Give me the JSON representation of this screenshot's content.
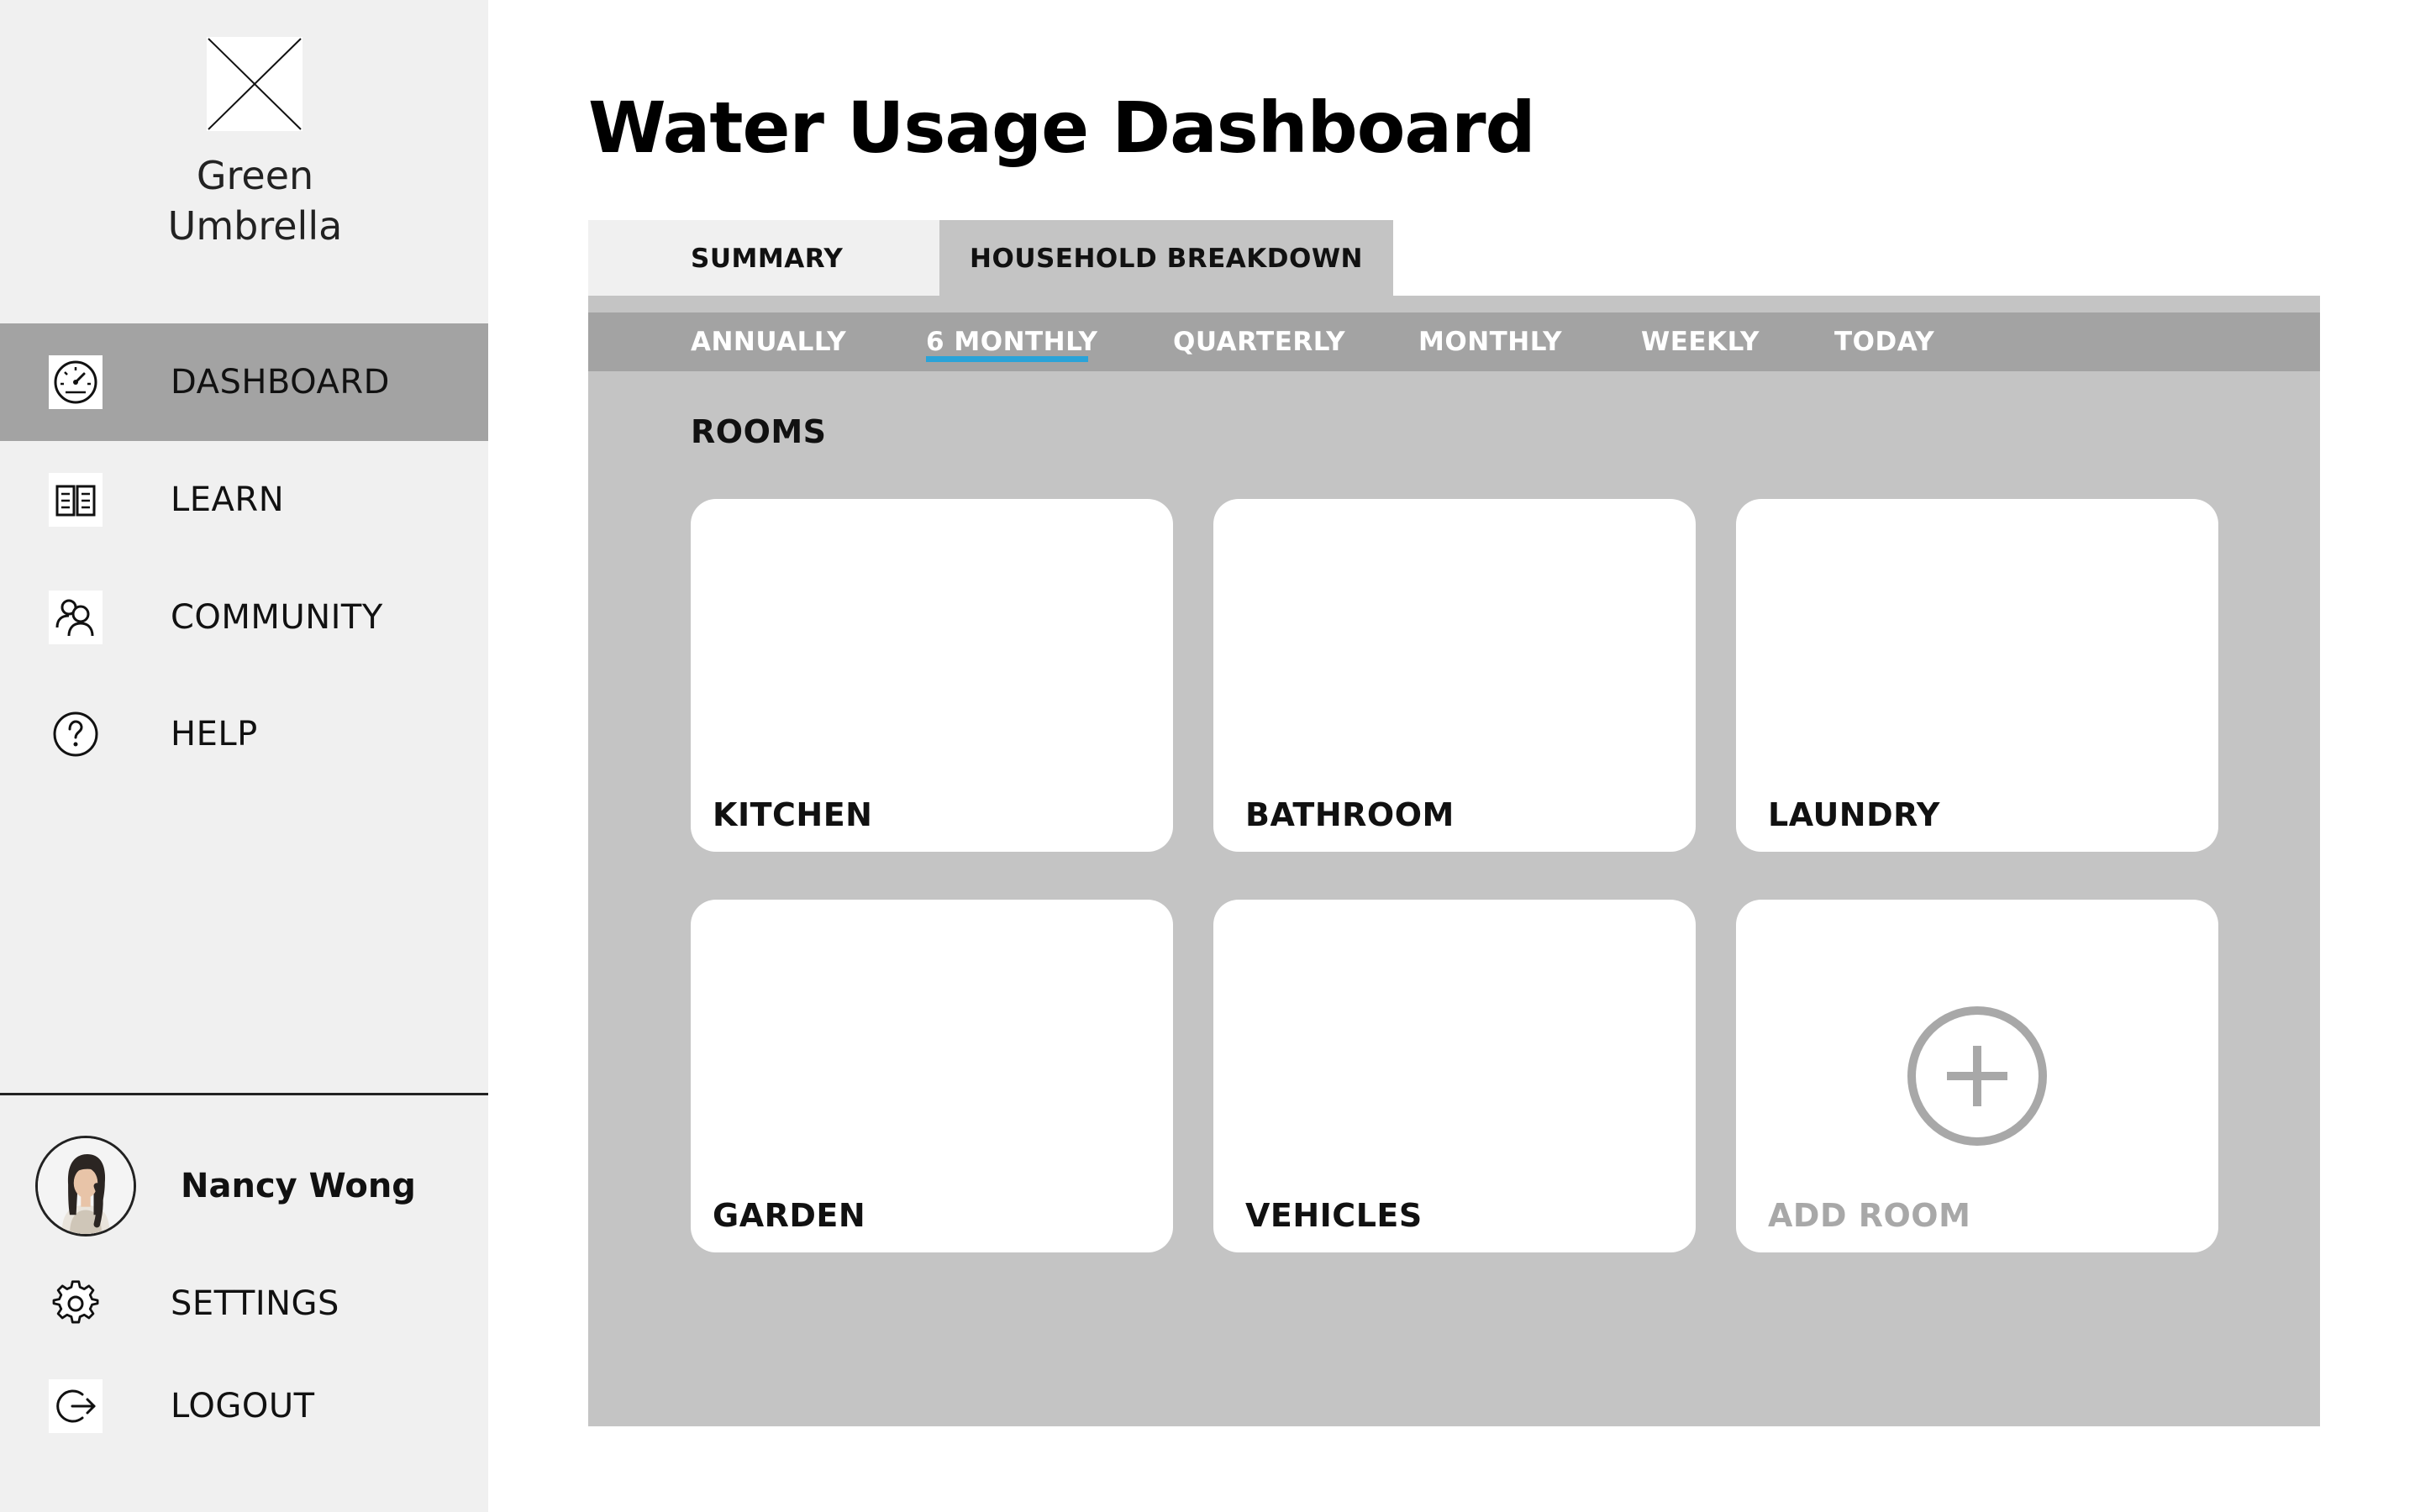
{
  "brand": {
    "line1": "Green",
    "line2": "Umbrella",
    "logo_icon": "image-placeholder-icon"
  },
  "sidebar": {
    "items": [
      {
        "label": "DASHBOARD",
        "icon": "speedometer-icon",
        "active": true
      },
      {
        "label": "LEARN",
        "icon": "book-icon",
        "active": false
      },
      {
        "label": "COMMUNITY",
        "icon": "people-icon",
        "active": false
      },
      {
        "label": "HELP",
        "icon": "question-circle-icon",
        "active": false
      }
    ],
    "user": {
      "name": "Nancy Wong",
      "avatar_icon": "user-avatar"
    },
    "footer_items": [
      {
        "label": "SETTINGS",
        "icon": "gear-icon"
      },
      {
        "label": "LOGOUT",
        "icon": "logout-icon"
      }
    ]
  },
  "main": {
    "title": "Water Usage Dashboard",
    "tabs": [
      {
        "label": "SUMMARY",
        "active": false
      },
      {
        "label": "HOUSEHOLD BREAKDOWN",
        "active": true
      }
    ],
    "periods": [
      {
        "label": "ANNUALLY",
        "active": false
      },
      {
        "label": "6 MONTHLY",
        "active": true
      },
      {
        "label": "QUARTERLY",
        "active": false
      },
      {
        "label": "MONTHLY",
        "active": false
      },
      {
        "label": "WEEKLY",
        "active": false
      },
      {
        "label": "TODAY",
        "active": false
      }
    ],
    "section_label": "ROOMS",
    "rooms": [
      {
        "label": "KITCHEN"
      },
      {
        "label": "BATHROOM"
      },
      {
        "label": "LAUNDRY"
      },
      {
        "label": "GARDEN"
      },
      {
        "label": "VEHICLES"
      }
    ],
    "add_room": {
      "label": "ADD ROOM",
      "icon": "plus-circle-icon"
    }
  },
  "colors": {
    "sidebar_bg": "#f0f0f0",
    "active_nav": "#a3a3a3",
    "panel_bg": "#c4c4c4",
    "period_bar": "#a3a3a3",
    "accent_underline": "#2aa3d8",
    "muted_text": "#a8a8a8"
  }
}
